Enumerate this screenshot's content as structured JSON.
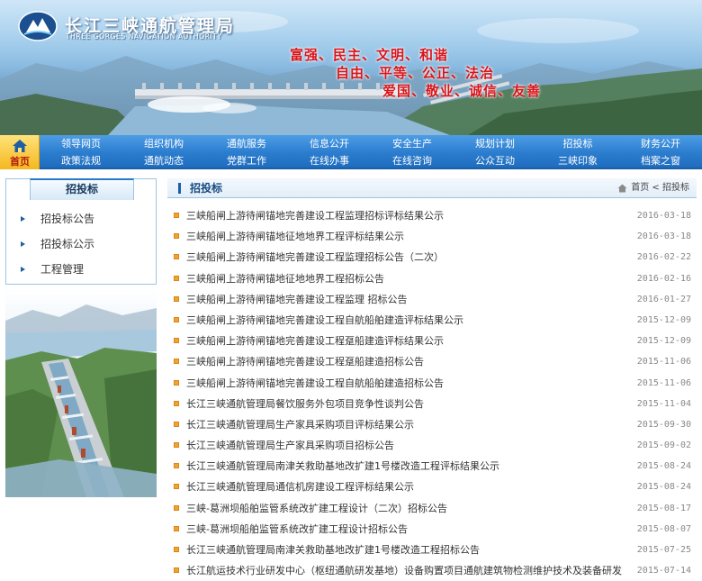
{
  "header": {
    "org_name_cn": "长江三峡通航管理局",
    "org_name_en": "THREE GORGES NAVIGATION AUTHORITY",
    "slogan_lines": [
      "富强、民主、文明、和谐",
      "自由、平等、公正、法治",
      "爱国、敬业、诚信、友善"
    ]
  },
  "nav": {
    "home_label": "首页",
    "row1": [
      "领导网页",
      "组织机构",
      "通航服务",
      "信息公开",
      "安全生产",
      "规划计划",
      "招投标",
      "财务公开"
    ],
    "row2": [
      "政策法规",
      "通航动态",
      "党群工作",
      "在线办事",
      "在线咨询",
      "公众互动",
      "三峡印象",
      "档案之窗"
    ]
  },
  "sidebar": {
    "title": "招投标",
    "items": [
      "招投标公告",
      "招投标公示",
      "工程管理"
    ]
  },
  "main": {
    "title": "招投标",
    "breadcrumb": {
      "home": "首页",
      "sep": "<",
      "current": "招投标"
    },
    "items": [
      {
        "title": "三峡船闸上游待闸锚地完善建设工程监理招标评标结果公示",
        "date": "2016-03-18"
      },
      {
        "title": "三峡船闸上游待闸锚地征地地界工程评标结果公示",
        "date": "2016-03-18"
      },
      {
        "title": "三峡船闸上游待闸锚地完善建设工程监理招标公告（二次）",
        "date": "2016-02-22"
      },
      {
        "title": "三峡船闸上游待闸锚地征地地界工程招标公告",
        "date": "2016-02-16"
      },
      {
        "title": "三峡船闸上游待闸锚地完善建设工程监理 招标公告",
        "date": "2016-01-27"
      },
      {
        "title": "三峡船闸上游待闸锚地完善建设工程自航船舶建造评标结果公示",
        "date": "2015-12-09"
      },
      {
        "title": "三峡船闸上游待闸锚地完善建设工程趸船建造评标结果公示",
        "date": "2015-12-09"
      },
      {
        "title": "三峡船闸上游待闸锚地完善建设工程趸船建造招标公告",
        "date": "2015-11-06"
      },
      {
        "title": "三峡船闸上游待闸锚地完善建设工程自航船舶建造招标公告",
        "date": "2015-11-06"
      },
      {
        "title": "长江三峡通航管理局餐饮服务外包项目竞争性谈判公告",
        "date": "2015-11-04"
      },
      {
        "title": "长江三峡通航管理局生产家具采购项目评标结果公示",
        "date": "2015-09-30"
      },
      {
        "title": "长江三峡通航管理局生产家具采购项目招标公告",
        "date": "2015-09-02"
      },
      {
        "title": "长江三峡通航管理局南津关救助基地改扩建1号楼改造工程评标结果公示",
        "date": "2015-08-24"
      },
      {
        "title": "长江三峡通航管理局通信机房建设工程评标结果公示",
        "date": "2015-08-24"
      },
      {
        "title": "三峡-葛洲坝船舶监管系统改扩建工程设计（二次）招标公告",
        "date": "2015-08-17"
      },
      {
        "title": "三峡-葛洲坝船舶监管系统改扩建工程设计招标公告",
        "date": "2015-08-07"
      },
      {
        "title": "长江三峡通航管理局南津关救助基地改扩建1号楼改造工程招标公告",
        "date": "2015-07-25"
      },
      {
        "title": "长江航运技术行业研发中心（枢纽通航研发基地）设备购置项目通航建筑物检测维护技术及装备研发",
        "date": "2015-07-14"
      }
    ]
  }
}
